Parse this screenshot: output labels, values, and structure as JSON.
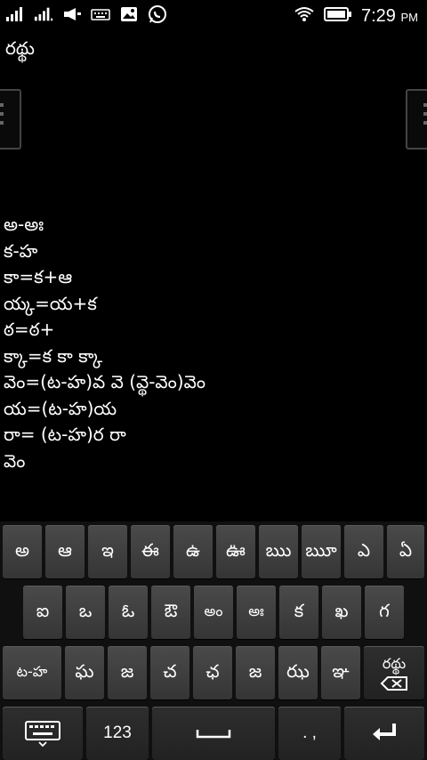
{
  "status_bar": {
    "time": "7:29",
    "ampm": "PM",
    "icons": [
      "signal-1-icon",
      "signal-2-icon",
      "megaphone-icon",
      "keyboard-icon",
      "image-icon",
      "whatsapp-icon",
      "wifi-icon",
      "battery-icon"
    ]
  },
  "editor": {
    "title": "రథ్థు",
    "lines": [
      "అ-అః",
      "క-హ",
      "కా=క+ఆ",
      "య్క=య+క",
      "ఠ=ఠ+",
      "క్కా=క కా క్కా",
      "వెం=(ట-హ)వ వె (వ్థె-వెం)వెం",
      "య=(ట-హ)య",
      "రా= (ట-హ)ర రా",
      "వెం"
    ]
  },
  "keyboard": {
    "row1": [
      "అ",
      "ఆ",
      "ఇ",
      "ఈ",
      "ఉ",
      "ఊ",
      "ఋ",
      "ౠ",
      "ఎ",
      "ఏ"
    ],
    "row2": [
      "ఐ",
      "ఒ",
      "ఓ",
      "ఔ",
      "అం",
      "అః",
      "క",
      "ఖ",
      "గ"
    ],
    "row3": [
      "ట-హ",
      "ఘ",
      "జ",
      "చ",
      "ఛ",
      "జ",
      "ఝ",
      "ఞ"
    ],
    "preview_label": "రథ్థు",
    "numbers_label": "123",
    "punct_label": ". ,"
  },
  "colors": {
    "background": "#000000",
    "key": "#404040",
    "text": "#ffffff"
  }
}
